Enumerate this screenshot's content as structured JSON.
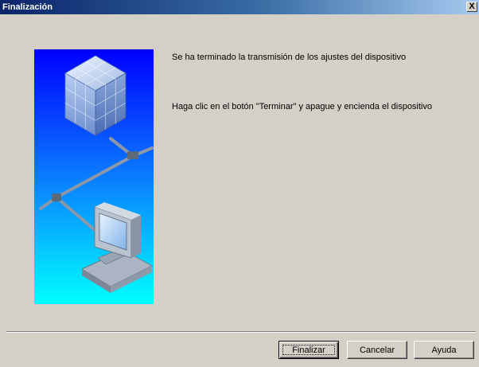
{
  "window": {
    "title": "Finalización",
    "close_label": "X"
  },
  "messages": {
    "line1": "Se ha terminado la transmisión de los ajustes del dispositivo",
    "line2": "Haga clic en el botón \"Terminar\" y apague y encienda el dispositivo"
  },
  "buttons": {
    "finish": "Finalizar",
    "cancel": "Cancelar",
    "help": "Ayuda"
  },
  "illustration": {
    "icon": "network-device-illustration",
    "colors": {
      "top": "#0000ff",
      "bottom": "#00ffff"
    }
  }
}
